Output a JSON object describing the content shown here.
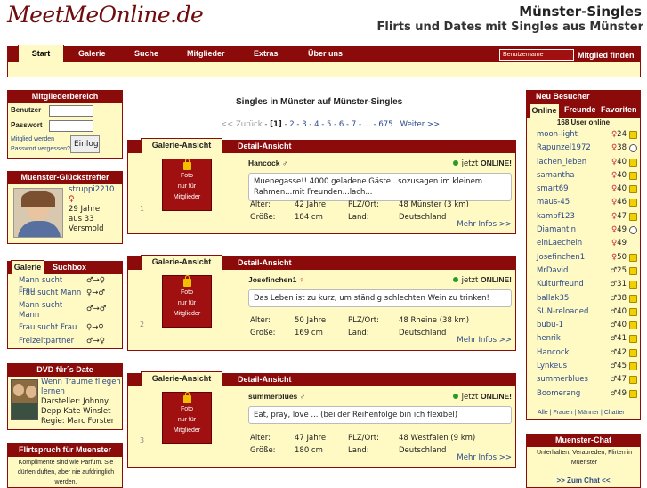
{
  "header": {
    "logo": "MeetMeOnline.de",
    "title": "Münster-Singles",
    "subtitle": "Flirts und Dates mit Singles aus Münster"
  },
  "nav": {
    "items": [
      "Start",
      "Galerie",
      "Suche",
      "Mitglieder",
      "Extras",
      "Über uns"
    ],
    "username_placeholder": "Benutzername",
    "find_label": "Mitglied finden"
  },
  "members_area": {
    "title": "Mitgliederbereich",
    "user_label": "Benutzer",
    "password_label": "Passwort",
    "register_link": "Mitglied werden",
    "forgot_link": "Passwort vergessen?",
    "login_button": "Einloggen"
  },
  "lucky": {
    "title": "Muenster-Glückstreffer",
    "username": "struppi2210",
    "gender": "♀",
    "age": "29 Jahre",
    "distance": "aus 33",
    "city": "Versmold"
  },
  "galerie_box": {
    "tabs": [
      "Galerie",
      "Suchbox"
    ],
    "items": [
      {
        "label": "Mann sucht Frau",
        "icon": "♂→♀"
      },
      {
        "label": "Frau sucht Mann",
        "icon": "♀→♂"
      },
      {
        "label": "Mann sucht Mann",
        "icon": "♂→♂"
      },
      {
        "label": "Frau sucht Frau",
        "icon": "♀→♀"
      },
      {
        "label": "Freizeitpartner",
        "icon": "♂→♀"
      }
    ]
  },
  "dvd": {
    "title": "DVD für´s Date",
    "movie": "Wenn Träume fliegen lernen",
    "actors": "Darsteller: Johnny Depp Kate Winslet",
    "director": "Regie: Marc Forster"
  },
  "flirt": {
    "title": "Flirtspruch für Muenster",
    "text": "Komplimente sind wie Parfüm. Sie dürfen duften, aber nie aufdringlich werden."
  },
  "main": {
    "title": "Singles in Münster auf Münster-Singles",
    "pager": {
      "prev": "<< Zurück",
      "current": "[1]",
      "pages": [
        "2",
        "3",
        "4",
        "5",
        "6",
        "7",
        "...",
        "675"
      ],
      "next": "Weiter >>"
    },
    "tab_gallery": "Galerie-Ansicht",
    "tab_detail": "Detail-Ansicht",
    "photo_text": [
      "Foto",
      "nur für",
      "Mitglieder"
    ],
    "online_label": "jetzt",
    "online_strong": "ONLINE!",
    "age_label": "Alter:",
    "height_label": "Größe:",
    "plz_label": "PLZ/Ort:",
    "country_label": "Land:",
    "more_label": "Mehr Infos >>",
    "cards": [
      {
        "index": "1",
        "name": "Hancock",
        "gender": "♂",
        "text": "Muenegasse!! 4000 geladene Gäste...sozusagen im kleinem Rahmen...mit Freunden...lach...",
        "age": "42 Jahre",
        "height": "184 cm",
        "plz": "48 Münster (3 km)",
        "country": "Deutschland"
      },
      {
        "index": "2",
        "name": "Josefinchen1",
        "gender": "♀",
        "text": "Das Leben ist zu kurz, um ständig schlechten Wein zu trinken!",
        "age": "50 Jahre",
        "height": "169 cm",
        "plz": "48 Rheine (38 km)",
        "country": "Deutschland"
      },
      {
        "index": "3",
        "name": "summerblues",
        "gender": "♂",
        "text": "Eat, pray, love ... (bei der Reihenfolge bin ich flexibel)",
        "age": "47 Jahre",
        "height": "180 cm",
        "plz": "48 Westfalen (9 km)",
        "country": "Deutschland"
      }
    ]
  },
  "visitors": {
    "title": "Neu  Besucher",
    "tabs": [
      "Online",
      "Freunde",
      "Favoriten"
    ],
    "count": "168 User online",
    "users": [
      {
        "name": "moon-light",
        "gender": "♀",
        "age": "24",
        "icon": "photo"
      },
      {
        "name": "Rapunzel1972",
        "gender": "♀",
        "age": "38",
        "icon": "chat"
      },
      {
        "name": "lachen_leben",
        "gender": "♀",
        "age": "40",
        "icon": "new"
      },
      {
        "name": "samantha",
        "gender": "♀",
        "age": "40",
        "icon": "photo"
      },
      {
        "name": "smart69",
        "gender": "♀",
        "age": "40",
        "icon": "photo"
      },
      {
        "name": "maus-45",
        "gender": "♀",
        "age": "46",
        "icon": "photo"
      },
      {
        "name": "kampf123",
        "gender": "♀",
        "age": "47",
        "icon": "photo"
      },
      {
        "name": "Diamantin",
        "gender": "♀",
        "age": "49",
        "icon": "chat"
      },
      {
        "name": "einLaecheln",
        "gender": "♀",
        "age": "49",
        "icon": "none"
      },
      {
        "name": "Josefinchen1",
        "gender": "♀",
        "age": "50",
        "icon": "photo"
      },
      {
        "name": "MrDavid",
        "gender": "♂",
        "age": "25",
        "icon": "photo"
      },
      {
        "name": "Kulturfreund",
        "gender": "♂",
        "age": "31",
        "icon": "photo"
      },
      {
        "name": "ballak35",
        "gender": "♂",
        "age": "38",
        "icon": "photo"
      },
      {
        "name": "SUN-reloaded",
        "gender": "♂",
        "age": "40",
        "icon": "photo"
      },
      {
        "name": "bubu-1",
        "gender": "♂",
        "age": "40",
        "icon": "photo"
      },
      {
        "name": "henrik",
        "gender": "♂",
        "age": "41",
        "icon": "photo"
      },
      {
        "name": "Hancock",
        "gender": "♂",
        "age": "42",
        "icon": "photo"
      },
      {
        "name": "Lynkeus",
        "gender": "♂",
        "age": "45",
        "icon": "photo"
      },
      {
        "name": "summerblues",
        "gender": "♂",
        "age": "47",
        "icon": "new"
      },
      {
        "name": "Boomerang",
        "gender": "♂",
        "age": "49",
        "icon": "photo"
      }
    ],
    "filter": "Alle | Frauen | Männer | Chatter"
  },
  "chat": {
    "title": "Muenster-Chat",
    "text": "Unterhalten, Verabreden, Flirten in Muenster",
    "link": ">> Zum Chat <<"
  }
}
